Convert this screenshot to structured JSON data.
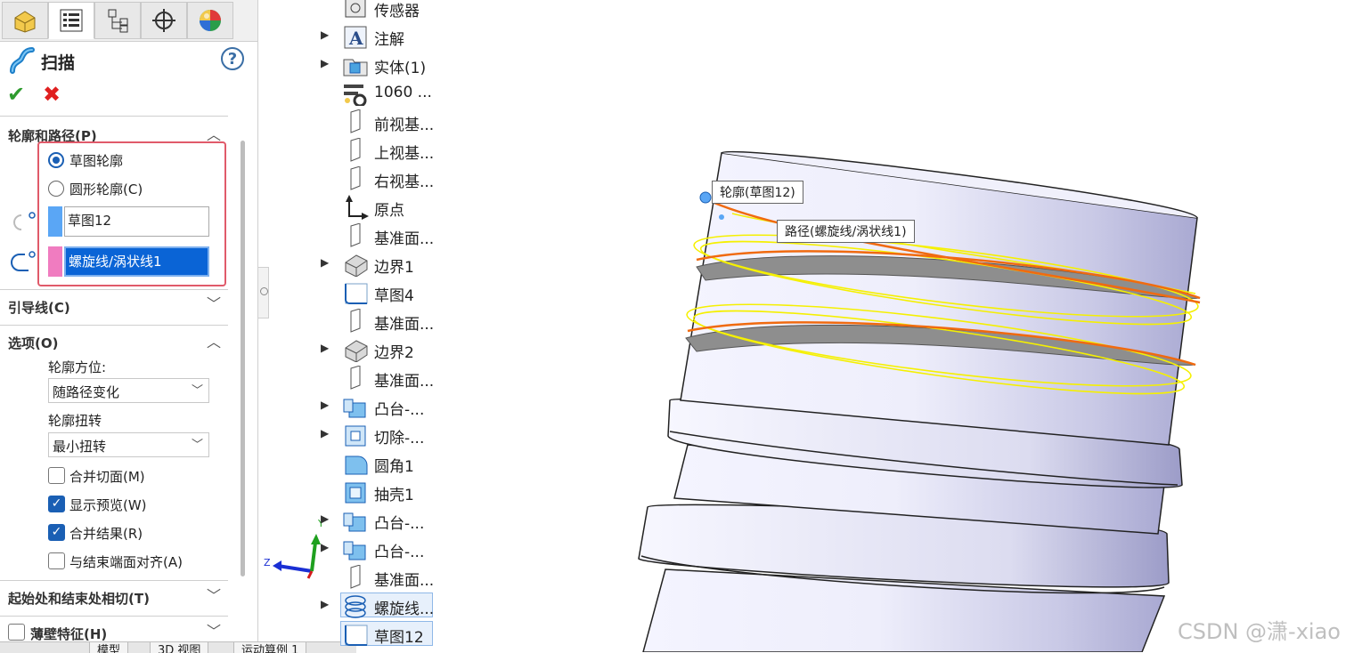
{
  "property_manager": {
    "title": "扫描",
    "help": "?",
    "ok": "✔",
    "cancel": "✖",
    "sections": {
      "profile_path": {
        "header": "轮廓和路径(P)",
        "radio_sketch": "草图轮廓",
        "radio_circular": "圆形轮廓(C)",
        "profile_value": "草图12",
        "path_value": "螺旋线/涡状线1"
      },
      "guide": {
        "header": "引导线(C)"
      },
      "options": {
        "header": "选项(O)",
        "orientation_label": "轮廓方位:",
        "orientation_value": "随路径变化",
        "twist_label": "轮廓扭转",
        "twist_value": "最小扭转",
        "merge_tangent": "合并切面(M)",
        "show_preview": "显示预览(W)",
        "merge_result": "合并结果(R)",
        "align_end": "与结束端面对齐(A)"
      },
      "tangency": {
        "header": "起始处和结束处相切(T)"
      },
      "thin": {
        "header": "薄壁特征(H)"
      }
    },
    "colors": {
      "profile_swatch": "#5aa6f5",
      "path_swatch": "#f07cc0",
      "accent": "#1a5fb4",
      "highlight_box": "#e05a6a"
    }
  },
  "bottom_tabs": [
    "模型",
    "3D 视图",
    "运动算例 1"
  ],
  "tree": {
    "items": [
      {
        "label": "传感器",
        "icon": "sensor-icon",
        "expand": ""
      },
      {
        "label": "注解",
        "icon": "annotation-icon",
        "expand": "▶"
      },
      {
        "label": "实体(1)",
        "icon": "solid-body-folder-icon",
        "expand": "▶"
      },
      {
        "label": "1060 ...",
        "icon": "material-icon",
        "expand": ""
      },
      {
        "label": "前视基...",
        "icon": "plane-icon",
        "expand": ""
      },
      {
        "label": "上视基...",
        "icon": "plane-icon",
        "expand": ""
      },
      {
        "label": "右视基...",
        "icon": "plane-icon",
        "expand": ""
      },
      {
        "label": "原点",
        "icon": "origin-icon",
        "expand": ""
      },
      {
        "label": "基准面...",
        "icon": "plane-icon",
        "expand": ""
      },
      {
        "label": "边界1",
        "icon": "boundary-icon",
        "expand": "▶"
      },
      {
        "label": "草图4",
        "icon": "sketch-icon",
        "expand": ""
      },
      {
        "label": "基准面...",
        "icon": "plane-icon",
        "expand": ""
      },
      {
        "label": "边界2",
        "icon": "boundary-icon",
        "expand": "▶"
      },
      {
        "label": "基准面...",
        "icon": "plane-icon",
        "expand": ""
      },
      {
        "label": "凸台-...",
        "icon": "boss-extrude-icon",
        "expand": "▶"
      },
      {
        "label": "切除-...",
        "icon": "cut-extrude-icon",
        "expand": "▶"
      },
      {
        "label": "圆角1",
        "icon": "fillet-icon",
        "expand": ""
      },
      {
        "label": "抽壳1",
        "icon": "shell-icon",
        "expand": ""
      },
      {
        "label": "凸台-...",
        "icon": "boss-extrude-icon",
        "expand": "▶"
      },
      {
        "label": "凸台-...",
        "icon": "boss-extrude-icon",
        "expand": "▶"
      },
      {
        "label": "基准面...",
        "icon": "plane-icon",
        "expand": ""
      },
      {
        "label": "螺旋线...",
        "icon": "helix-icon",
        "expand": "▶"
      },
      {
        "label": "草图12",
        "icon": "sketch-icon",
        "expand": ""
      }
    ]
  },
  "viewport": {
    "callout_profile": "轮廓(草图12)",
    "callout_path": "路径(螺旋线/涡状线1)",
    "triad_z": "Z",
    "triad_y": "Y",
    "watermark": "CSDN @潇-xiao"
  }
}
